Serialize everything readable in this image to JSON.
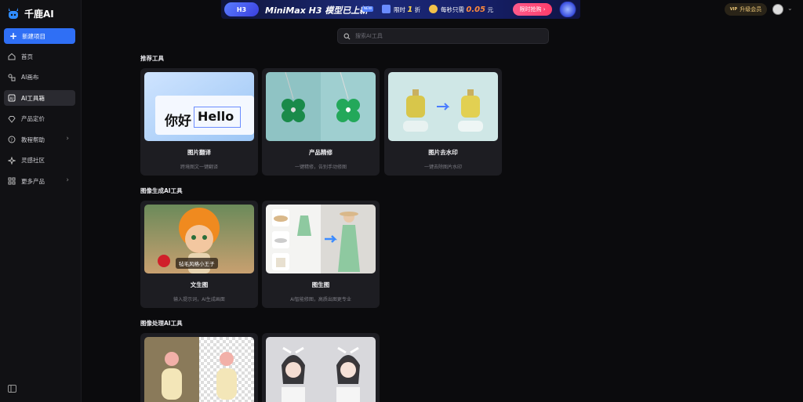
{
  "app": {
    "name": "千鹿AI"
  },
  "sidebar": {
    "new_project": "新建项目",
    "items": [
      {
        "label": "首页",
        "icon": "home-icon"
      },
      {
        "label": "AI画布",
        "icon": "canvas-icon"
      },
      {
        "label": "AI工具箱",
        "icon": "toolbox-icon",
        "active": true
      },
      {
        "label": "产品定价",
        "icon": "pricing-icon"
      },
      {
        "label": "教程帮助",
        "icon": "help-icon",
        "has_submenu": true
      },
      {
        "label": "灵感社区",
        "icon": "sparkle-icon"
      },
      {
        "label": "更多产品",
        "icon": "grid-icon",
        "has_submenu": true
      }
    ]
  },
  "banner": {
    "badge": "H3",
    "title": "MiniMax H3 模型已上新",
    "new_tag": "NEW",
    "limit_prefix": "限时",
    "limit_value": "1",
    "limit_suffix": "折",
    "price_prefix": "每秒只需",
    "price_value": "0.05",
    "price_suffix": "元",
    "cta": "限时抢购 ›"
  },
  "header": {
    "vip_tag": "VIP",
    "upgrade": "升级会员"
  },
  "search": {
    "placeholder": "搜索AI工具",
    "value": ""
  },
  "sections": [
    {
      "title": "推荐工具",
      "cards": [
        {
          "title": "图片翻译",
          "desc": "跨境图文一键翻译",
          "thumb_text_left": "你好",
          "thumb_text_right": "Hello"
        },
        {
          "title": "产品精修",
          "desc": "一键精修，告别手动修图"
        },
        {
          "title": "图片去水印",
          "desc": "一键去除图片水印"
        }
      ]
    },
    {
      "title": "图像生成AI工具",
      "cards": [
        {
          "title": "文生图",
          "desc": "输入提示词，AI生成画面",
          "sticker": "毡毛风格小王子"
        },
        {
          "title": "图生图",
          "desc": "AI智能修图，高质出图更专业"
        }
      ]
    },
    {
      "title": "图像处理AI工具",
      "cards": [
        {},
        {}
      ]
    }
  ],
  "colors": {
    "accent": "#2f6ff5",
    "background": "#0b0b0d",
    "card": "#1d1d22"
  }
}
